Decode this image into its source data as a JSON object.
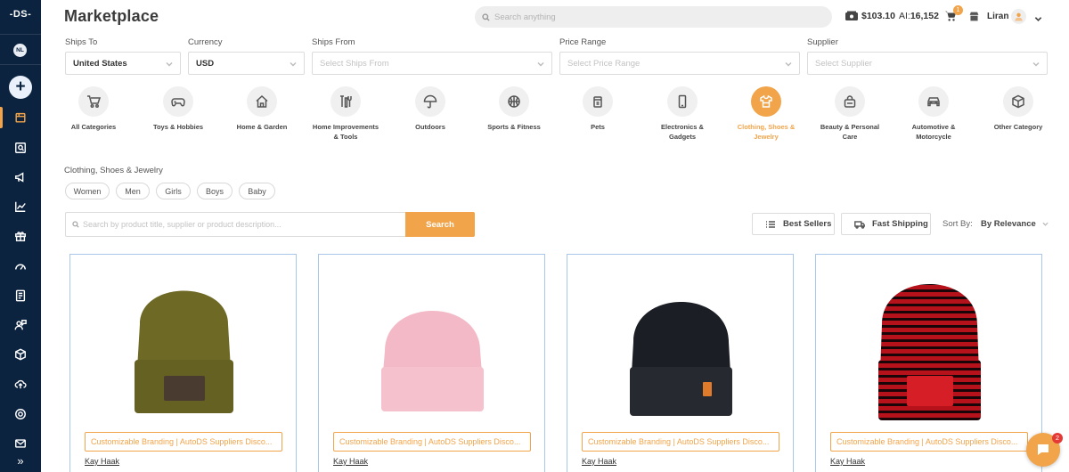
{
  "app": {
    "logo_text": "-DS-",
    "user_initials": "NL",
    "add_label": "+",
    "expand_label": "»"
  },
  "header": {
    "title": "Marketplace",
    "search_placeholder": "Search anything",
    "balance": "$103.10",
    "ai_prefix": "AI:",
    "ai_credits": "16,152",
    "cart_count": "1",
    "user_name": "Liran"
  },
  "filters": {
    "ships_to": {
      "label": "Ships To",
      "value": "United States"
    },
    "currency": {
      "label": "Currency",
      "value": "USD"
    },
    "ships_from": {
      "label": "Ships From",
      "placeholder": "Select Ships From"
    },
    "price_range": {
      "label": "Price Range",
      "placeholder": "Select Price Range"
    },
    "supplier": {
      "label": "Supplier",
      "placeholder": "Select Supplier"
    }
  },
  "categories": [
    {
      "label": "All Categories",
      "icon": "cart-icon"
    },
    {
      "label": "Toys & Hobbies",
      "icon": "gamepad-icon"
    },
    {
      "label": "Home & Garden",
      "icon": "home-icon"
    },
    {
      "label": "Home Improvements & Tools",
      "icon": "tools-icon"
    },
    {
      "label": "Outdoors",
      "icon": "umbrella-icon"
    },
    {
      "label": "Sports & Fitness",
      "icon": "basketball-icon"
    },
    {
      "label": "Pets",
      "icon": "pet-bag-icon"
    },
    {
      "label": "Electronics & Gadgets",
      "icon": "phone-icon"
    },
    {
      "label": "Clothing, Shoes & Jewelry",
      "icon": "shirt-icon",
      "active": true
    },
    {
      "label": "Beauty & Personal Care",
      "icon": "beauty-bag-icon"
    },
    {
      "label": "Automotive & Motorcycle",
      "icon": "car-icon"
    },
    {
      "label": "Other Category",
      "icon": "box-icon"
    }
  ],
  "subcategory": {
    "title": "Clothing, Shoes & Jewelry",
    "chips": [
      "Women",
      "Men",
      "Girls",
      "Boys",
      "Baby"
    ]
  },
  "product_search": {
    "placeholder": "Search by product title, supplier or product description...",
    "button": "Search"
  },
  "toolbar": {
    "best_sellers": "Best Sellers",
    "fast_shipping": "Fast Shipping",
    "sort_label": "Sort By:",
    "sort_value": "By Relevance"
  },
  "products": [
    {
      "tag": "Customizable Branding | AutoDS Suppliers Disco...",
      "supplier": "Kay Haak",
      "color": "#6e6a26",
      "accent": "#4a3b30"
    },
    {
      "tag": "Customizable Branding | AutoDS Suppliers Disco...",
      "supplier": "Kay Haak",
      "color": "#f3b9c7",
      "accent": "#f3b9c7"
    },
    {
      "tag": "Customizable Branding | AutoDS Suppliers Disco...",
      "supplier": "Kay Haak",
      "color": "#1b1e24",
      "accent": "#e07b2c"
    },
    {
      "tag": "Customizable Branding | AutoDS Suppliers Disco...",
      "supplier": "Kay Haak",
      "color": "#b5121b",
      "accent": "#d61e27"
    }
  ],
  "chat": {
    "badge": "2"
  },
  "colors": {
    "accent": "#f1a44a",
    "sidebar": "#0c2340",
    "card_border": "#a9c7e8"
  }
}
